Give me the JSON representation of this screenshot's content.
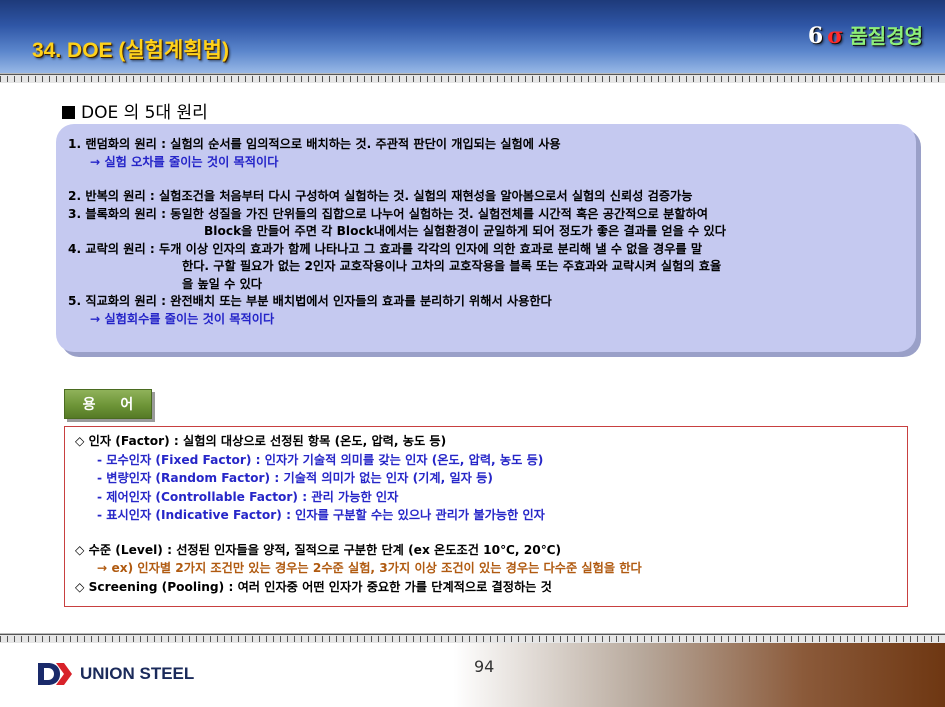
{
  "header": {
    "title": "34. DOE (실험계획법)",
    "brand_num": "6",
    "brand_sigma": "σ",
    "brand_text": "품질경영"
  },
  "section_title": "DOE 의 5대 원리",
  "principles": {
    "p1": "1. 랜덤화의 원리 : 실험의 순서를 임의적으로 배치하는 것. 주관적 판단이 개입되는 실험에 사용",
    "p1_note": "→ 실험 오차를 줄이는 것이 목적이다",
    "p2": "2. 반복의 원리 : 실험조건을 처음부터 다시 구성하여 실험하는 것. 실험의 재현성을 알아봄으로서 실험의 신뢰성 검증가능",
    "p3": "3. 블록화의 원리 : 동일한 성질을 가진 단위들의 집합으로 나누어 실험하는 것. 실험전체를 시간적 혹은 공간적으로 분할하여",
    "p3_cont": "Block을  만들어 주면 각 Block내에서는 실험환경이 균일하게 되어 정도가 좋은 결과를 얻을 수 있다",
    "p4": "4. 교락의 원리 : 두개 이상 인자의 효과가 함께 나타나고 그 효과를 각각의 인자에 의한 효과로 분리해 낼 수 없을 경우를 말",
    "p4_cont1": "한다. 구할 필요가 없는 2인자 교호작용이나 고차의 교호작용을 블록 또는 주효과와 교락시켜 실험의 효율",
    "p4_cont2": "을 높일 수 있다",
    "p5": "5. 직교화의 원리 : 완전배치 또는 부분 배치법에서 인자들의 효과를 분리하기 위해서 사용한다",
    "p5_note": "→ 실험회수를 줄이는 것이 목적이다"
  },
  "term_button": "용 어",
  "terms": {
    "factor": "◇ 인자 (Factor) : 실험의 대상으로 선정된 항목 (온도, 압력, 농도 등)",
    "fixed": "- 모수인자 (Fixed Factor) : 인자가 기술적 의미를 갖는 인자 (온도, 압력, 농도 등)",
    "random": "- 변량인자 (Random Factor) : 기술적 의미가 없는 인자 (기계, 일자 등)",
    "controllable": "- 제어인자 (Controllable  Factor) : 관리 가능한 인자",
    "indicative": "- 표시인자 (Indicative  Factor) : 인자를 구분할 수는 있으나 관리가 불가능한 인자",
    "level": "◇ 수준 (Level) : 선정된 인자들을 양적, 질적으로 구분한 단계 (ex  온도조건   10℃, 20℃)",
    "level_ex": "→ ex) 인자별 2가지 조건만 있는 경우는 2수준 실험, 3가지 이상 조건이 있는 경우는 다수준 실험을 한다",
    "screening": "◇ Screening  (Pooling)  : 여러 인자중 어떤 인자가 중요한 가를 단계적으로 결정하는 것"
  },
  "footer": {
    "company": "UNION STEEL",
    "page_number": "94"
  },
  "colors": {
    "title": "#ffd21a",
    "note_blue": "#2424c8",
    "example_orange": "#b05a10",
    "principles_bg": "#c5c9f0",
    "terms_border": "#c84040"
  }
}
